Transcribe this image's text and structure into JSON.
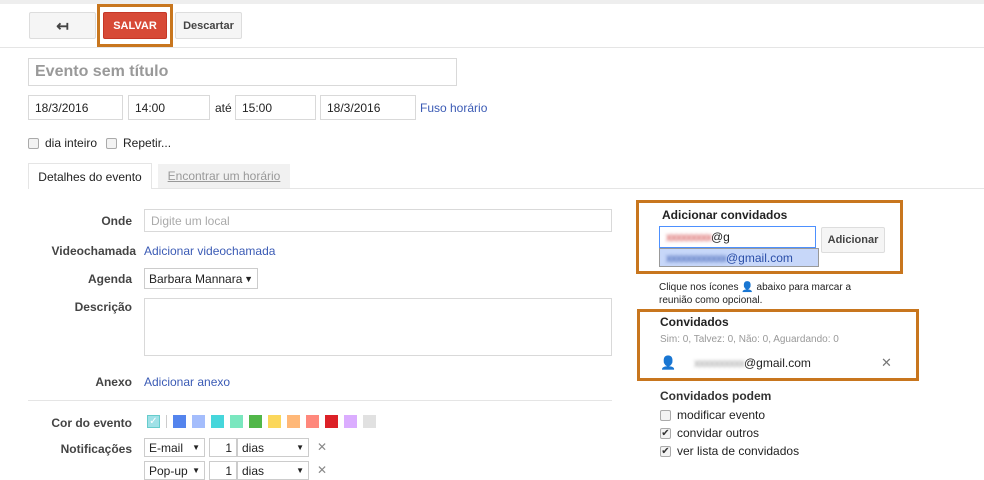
{
  "toolbar": {
    "back_icon": "arrow-back-icon",
    "save": "SALVAR",
    "discard": "Descartar"
  },
  "event": {
    "title_placeholder": "Evento sem título",
    "start_date": "18/3/2016",
    "start_time": "14:00",
    "until": "até",
    "end_time": "15:00",
    "end_date": "18/3/2016",
    "timezone": "Fuso horário",
    "all_day": "dia inteiro",
    "repeat": "Repetir..."
  },
  "tabs": [
    {
      "label": "Detalhes do evento"
    },
    {
      "label": "Encontrar um horário"
    }
  ],
  "details": {
    "where_label": "Onde",
    "where_placeholder": "Digite um local",
    "video_label": "Videochamada",
    "video_link": "Adicionar videochamada",
    "calendar_label": "Agenda",
    "calendar_value": "Barbara Mannara",
    "description_label": "Descrição",
    "attachment_label": "Anexo",
    "attachment_link": "Adicionar anexo",
    "color_label": "Cor do evento",
    "notifications_label": "Notificações"
  },
  "colors": [
    "#5484ed",
    "#a4bdfc",
    "#46d6db",
    "#7ae7bf",
    "#51b749",
    "#fbd75b",
    "#ffb878",
    "#ff887c",
    "#dc2127",
    "#dbadff",
    "#e1e1e1"
  ],
  "selected_color": "#9fe1e7",
  "notifications": [
    {
      "method": "E-mail",
      "amount": "1",
      "unit": "dias"
    },
    {
      "method": "Pop-up",
      "amount": "1",
      "unit": "dias"
    }
  ],
  "guests": {
    "add_title": "Adicionar convidados",
    "input_value": "@g",
    "suggestion": "@gmail.com",
    "add_button": "Adicionar",
    "hint": "Clique nos ícones",
    "hint2": "abaixo para marcar a reunião como opcional.",
    "list_title": "Convidados",
    "summary": "Sim: 0, Talvez: 0, Não: 0, Aguardando: 0",
    "guest_email": "@gmail.com",
    "perms_title": "Convidados podem",
    "perms": [
      {
        "label": "modificar evento",
        "checked": false
      },
      {
        "label": "convidar outros",
        "checked": true
      },
      {
        "label": "ver lista de convidados",
        "checked": true
      }
    ]
  },
  "accent": "#d14836",
  "highlight": "#c8761e"
}
